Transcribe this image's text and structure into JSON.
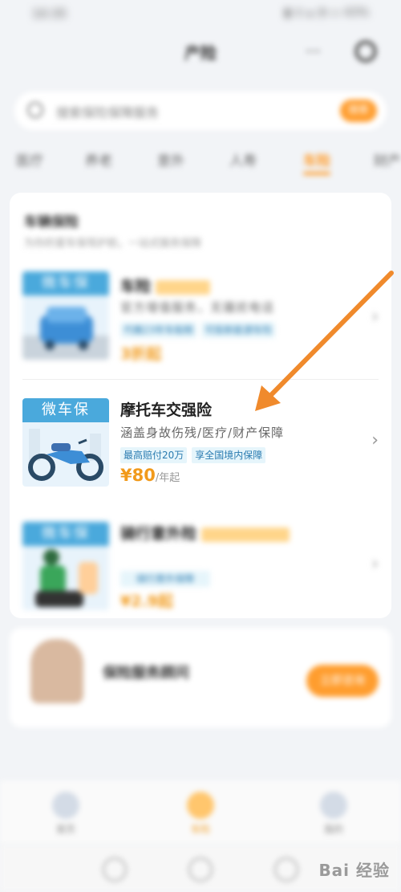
{
  "status_bar": {
    "time": "10:35",
    "icons": "▮ ⊙ ▴ ◔ ▭ 43%"
  },
  "header": {
    "title": "产险",
    "more": "···"
  },
  "search": {
    "placeholder": "搜索保险保障服务",
    "button": "搜索"
  },
  "tabs": [
    {
      "label": "医疗"
    },
    {
      "label": "养老"
    },
    {
      "label": "意外"
    },
    {
      "label": "人寿"
    },
    {
      "label": "车险",
      "active": true
    },
    {
      "label": "财产"
    }
  ],
  "section": {
    "title": "车辆保险",
    "subtitle": "为你的爱车保驾护航，一站式服务保障"
  },
  "products": [
    {
      "tag": "微车保",
      "name": "车险",
      "description": "官方增值服务，无骚扰电话",
      "chips": [
        "代缴23年车船税",
        "可投新能源车险"
      ],
      "price": "3折起"
    },
    {
      "tag": "微车保",
      "name": "摩托车交强险",
      "description": "涵盖身故伤残/医疗/财产保障",
      "chips": [
        "最高赔付20万",
        "享全国境内保障"
      ],
      "price_amount": "¥80",
      "price_unit": "/年起"
    },
    {
      "tag": "微车保",
      "name": "骑行意外险",
      "description": "",
      "chips": [
        "骑行意外保障"
      ],
      "price": "¥2.9起"
    }
  ],
  "agent": {
    "name": "保险服务顾问",
    "button": "立即咨询"
  },
  "bottom_nav": [
    {
      "label": "首页"
    },
    {
      "label": "车险",
      "active": true
    },
    {
      "label": "我的"
    }
  ],
  "watermark": "Bai 经验",
  "colors": {
    "accent": "#ff9d2e",
    "chip_text": "#2a7bb0",
    "thumb_tag": "#4aa9dc",
    "price": "#f19a1b",
    "arrow": "#f08a2c"
  }
}
